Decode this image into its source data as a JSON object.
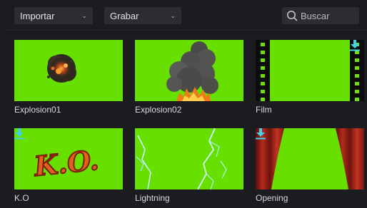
{
  "toolbar": {
    "import_label": "Importar",
    "record_label": "Grabar",
    "search_placeholder": "Buscar"
  },
  "items": [
    {
      "label": "Explosion01",
      "icon": "explosion-small-thumbnail",
      "downloadable": false
    },
    {
      "label": "Explosion02",
      "icon": "smoke-fire-thumbnail",
      "downloadable": false
    },
    {
      "label": "Film",
      "icon": "film-strip-thumbnail",
      "downloadable": true
    },
    {
      "label": "K.O",
      "icon": "ko-text-thumbnail",
      "downloadable": true
    },
    {
      "label": "Lightning",
      "icon": "lightning-thumbnail",
      "downloadable": false
    },
    {
      "label": "Opening",
      "icon": "curtain-thumbnail",
      "downloadable": true
    }
  ],
  "colors": {
    "background": "#1b1c20",
    "control_bg": "#2b2d33",
    "chroma_green": "#67e000",
    "download_icon": "#41d1ee"
  }
}
